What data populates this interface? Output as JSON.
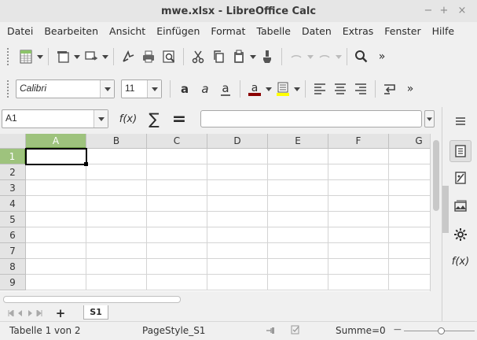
{
  "window": {
    "title": "mwe.xlsx - LibreOffice Calc",
    "min": "−",
    "max": "+",
    "close": "×"
  },
  "menu": [
    "Datei",
    "Bearbeiten",
    "Ansicht",
    "Einfügen",
    "Format",
    "Tabelle",
    "Daten",
    "Extras",
    "Fenster",
    "Hilfe"
  ],
  "formatting": {
    "font_name": "Calibri",
    "font_size": "11",
    "font_color": "#8b0000",
    "highlight_color": "#ffff00"
  },
  "formula": {
    "name_box": "A1",
    "function_wizard": "f(x)",
    "sum": "∑",
    "equals": "=",
    "input": ""
  },
  "grid": {
    "columns": [
      "A",
      "B",
      "C",
      "D",
      "E",
      "F",
      "G"
    ],
    "rows": [
      "1",
      "2",
      "3",
      "4",
      "5",
      "6",
      "7",
      "8",
      "9"
    ],
    "selected_cell": "A1",
    "selection_color": "#9ec37d"
  },
  "sheets": {
    "add": "+",
    "tabs": [
      "S1"
    ]
  },
  "status": {
    "sheet": "Tabelle 1 von 2",
    "page_style": "PageStyle_S1",
    "sum": "Summe=0",
    "zoom_out": "−"
  },
  "sidebar": {
    "functions": "f(x)"
  },
  "icons": [
    "spreadsheet-icon",
    "paste-icon",
    "cut-icon",
    "copy-icon",
    "clone-formatting-icon",
    "print-icon",
    "print-preview-icon",
    "find-icon",
    "bold-icon",
    "italic-icon",
    "underline-icon",
    "align-left-icon",
    "align-center-icon",
    "align-right-icon",
    "wrap-text-icon",
    "properties-icon",
    "navigator-icon",
    "gallery-icon",
    "gear-icon"
  ]
}
